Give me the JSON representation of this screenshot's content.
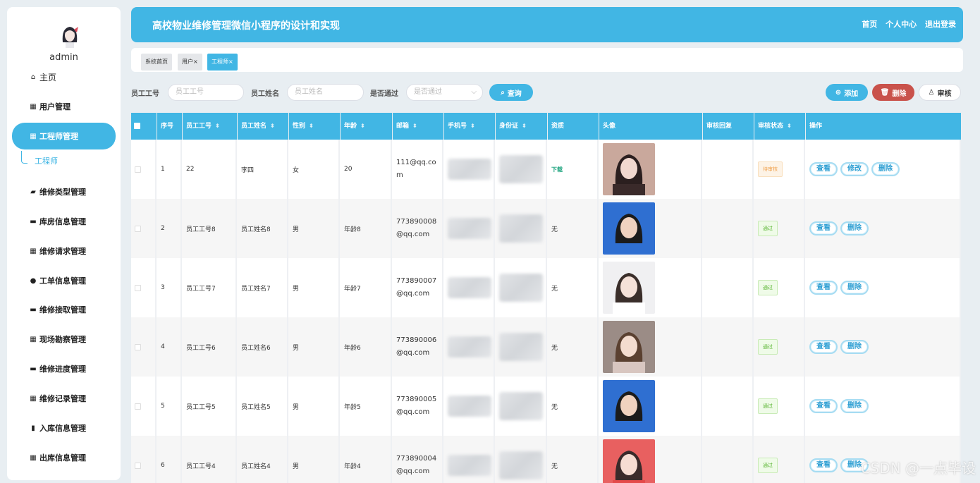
{
  "user": {
    "name": "admin"
  },
  "sidebar": {
    "items": [
      {
        "label": "主页",
        "icon": "home-icon",
        "glyph": "⌂"
      },
      {
        "label": "用户管理",
        "icon": "grid-icon",
        "glyph": "▦"
      },
      {
        "label": "工程师管理",
        "icon": "grid-icon",
        "glyph": "▦"
      },
      {
        "label": "维修类型管理",
        "icon": "folder-icon",
        "glyph": "▰"
      },
      {
        "label": "库房信息管理",
        "icon": "chat-icon",
        "glyph": "▬"
      },
      {
        "label": "维修请求管理",
        "icon": "grid-icon",
        "glyph": "▦"
      },
      {
        "label": "工单信息管理",
        "icon": "user-icon",
        "glyph": "●"
      },
      {
        "label": "维修接取管理",
        "icon": "monitor-icon",
        "glyph": "▬"
      },
      {
        "label": "现场勘察管理",
        "icon": "grid-icon",
        "glyph": "▦"
      },
      {
        "label": "维修进度管理",
        "icon": "box-icon",
        "glyph": "▬"
      },
      {
        "label": "维修记录管理",
        "icon": "grid-icon",
        "glyph": "▦"
      },
      {
        "label": "入库信息管理",
        "icon": "clipboard-icon",
        "glyph": "▮"
      },
      {
        "label": "出库信息管理",
        "icon": "grid-icon",
        "glyph": "▦"
      }
    ],
    "sub_item": "工程师"
  },
  "header": {
    "title": "高校物业维修管理微信小程序的设计和实现",
    "links": [
      "首页",
      "个人中心",
      "退出登录"
    ]
  },
  "tabs": [
    "系统首页",
    "用户×",
    "工程师×"
  ],
  "search": {
    "emp_no_label": "员工工号",
    "emp_no_placeholder": "员工工号",
    "emp_name_label": "员工姓名",
    "emp_name_placeholder": "员工姓名",
    "passed_label": "是否通过",
    "passed_placeholder": "是否通过",
    "query_label": "查询"
  },
  "actions": {
    "add": "添加",
    "delete": "删除",
    "audit": "审核"
  },
  "table": {
    "columns": [
      "",
      "序号",
      "员工工号",
      "员工姓名",
      "性别",
      "年龄",
      "邮箱",
      "手机号",
      "身份证",
      "资质",
      "头像",
      "审核回复",
      "审核状态",
      "操作"
    ],
    "rows": [
      {
        "index": "1",
        "emp_no": "22",
        "name": "李四",
        "gender": "女",
        "age": "20",
        "email": "111@qq.com",
        "qualification": "下载",
        "status": "待审核",
        "ops": [
          "查看",
          "修改",
          "删除"
        ]
      },
      {
        "index": "2",
        "emp_no": "员工工号8",
        "name": "员工姓名8",
        "gender": "男",
        "age": "年龄8",
        "email": "773890008@qq.com",
        "qualification": "无",
        "status": "通过",
        "ops": [
          "查看",
          "删除"
        ]
      },
      {
        "index": "3",
        "emp_no": "员工工号7",
        "name": "员工姓名7",
        "gender": "男",
        "age": "年龄7",
        "email": "773890007@qq.com",
        "qualification": "无",
        "status": "通过",
        "ops": [
          "查看",
          "删除"
        ]
      },
      {
        "index": "4",
        "emp_no": "员工工号6",
        "name": "员工姓名6",
        "gender": "男",
        "age": "年龄6",
        "email": "773890006@qq.com",
        "qualification": "无",
        "status": "通过",
        "ops": [
          "查看",
          "删除"
        ]
      },
      {
        "index": "5",
        "emp_no": "员工工号5",
        "name": "员工姓名5",
        "gender": "男",
        "age": "年龄5",
        "email": "773890005@qq.com",
        "qualification": "无",
        "status": "通过",
        "ops": [
          "查看",
          "删除"
        ]
      },
      {
        "index": "6",
        "emp_no": "员工工号4",
        "name": "员工姓名4",
        "gender": "男",
        "age": "年龄4",
        "email": "773890004@qq.com",
        "qualification": "无",
        "status": "通过",
        "ops": [
          "查看",
          "删除"
        ]
      }
    ]
  },
  "watermark": "CSDN @一点毕设",
  "colors": {
    "accent": "#41b6e4",
    "danger": "#c9524b",
    "success": "#58b431",
    "warning": "#f0a04b"
  }
}
